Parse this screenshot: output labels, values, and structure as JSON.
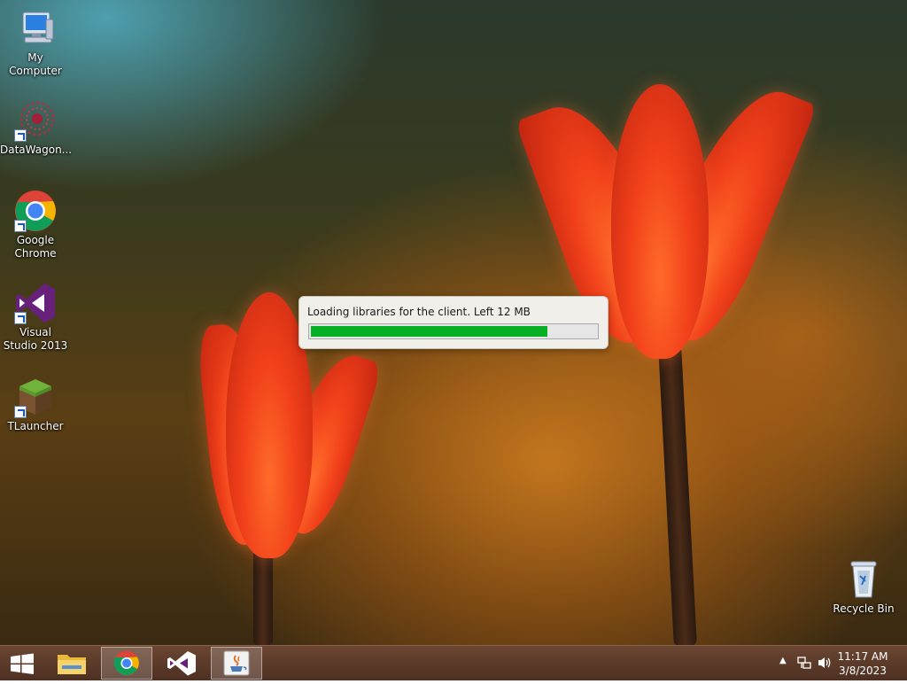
{
  "desktop": {
    "icons": [
      {
        "label": "My Computer"
      },
      {
        "label": "DataWagon..."
      },
      {
        "label": "Google Chrome"
      },
      {
        "label": "Visual Studio 2013"
      },
      {
        "label": "TLauncher"
      },
      {
        "label": "Recycle Bin"
      }
    ]
  },
  "loader": {
    "message": "Loading libraries for the client. Left 12 MB",
    "progress_percent": 83,
    "progress_color": "#06b025"
  },
  "taskbar": {
    "start_icon": "windows-logo-icon",
    "pinned": [
      {
        "name": "file-explorer-icon"
      },
      {
        "name": "chrome-icon"
      },
      {
        "name": "visual-studio-icon"
      },
      {
        "name": "java-icon"
      }
    ],
    "tray": {
      "time": "11:17 AM",
      "date": "3/8/2023"
    }
  }
}
